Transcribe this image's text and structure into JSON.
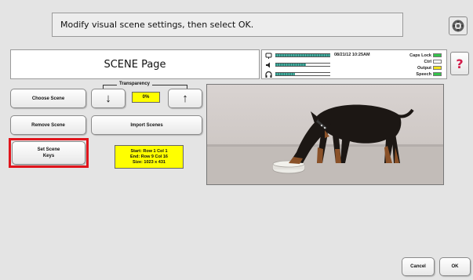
{
  "instruction": "Modify visual scene settings, then select OK.",
  "icons": {
    "settings": "settings-gear-icon",
    "microphone": "microphone-icon",
    "speaker": "speaker-icon",
    "headphones": "headphones-icon",
    "up": "arrow-up-icon",
    "down": "arrow-down-icon"
  },
  "page_title": "SCENE Page",
  "status": {
    "datetime": "08/21/12 10:25AM",
    "meters": [
      {
        "icon": "microphone-icon",
        "level": 1.0
      },
      {
        "icon": "speaker-icon",
        "level": 0.55
      },
      {
        "icon": "headphones-icon",
        "level": 0.35
      }
    ],
    "indicators": [
      {
        "label": "Caps Lock",
        "color": "#33c24a"
      },
      {
        "label": "Ctrl",
        "color": "#ffffff"
      },
      {
        "label": "Output",
        "color": "#f2e21a"
      },
      {
        "label": "Speech",
        "color": "#33c24a"
      }
    ]
  },
  "help_label": "?",
  "buttons": {
    "choose_scene": "Choose Scene",
    "remove_scene": "Remove Scene",
    "import_scenes": "Import Scenes",
    "set_scene_keys_line1": "Set Scene",
    "set_scene_keys_line2": "Keys",
    "cancel": "Cancel",
    "ok": "OK"
  },
  "transparency": {
    "label": "Transparency",
    "value": "0%",
    "down_glyph": "↓",
    "up_glyph": "↑"
  },
  "scene_info": {
    "start": "Start: Row 1 Col 1",
    "end": "End: Row 9 Col 16",
    "size": "Size: 1023 x 431"
  },
  "colors": {
    "highlight": "#e0151c",
    "info_bg": "#ffff00",
    "help": "#d21c4a"
  }
}
